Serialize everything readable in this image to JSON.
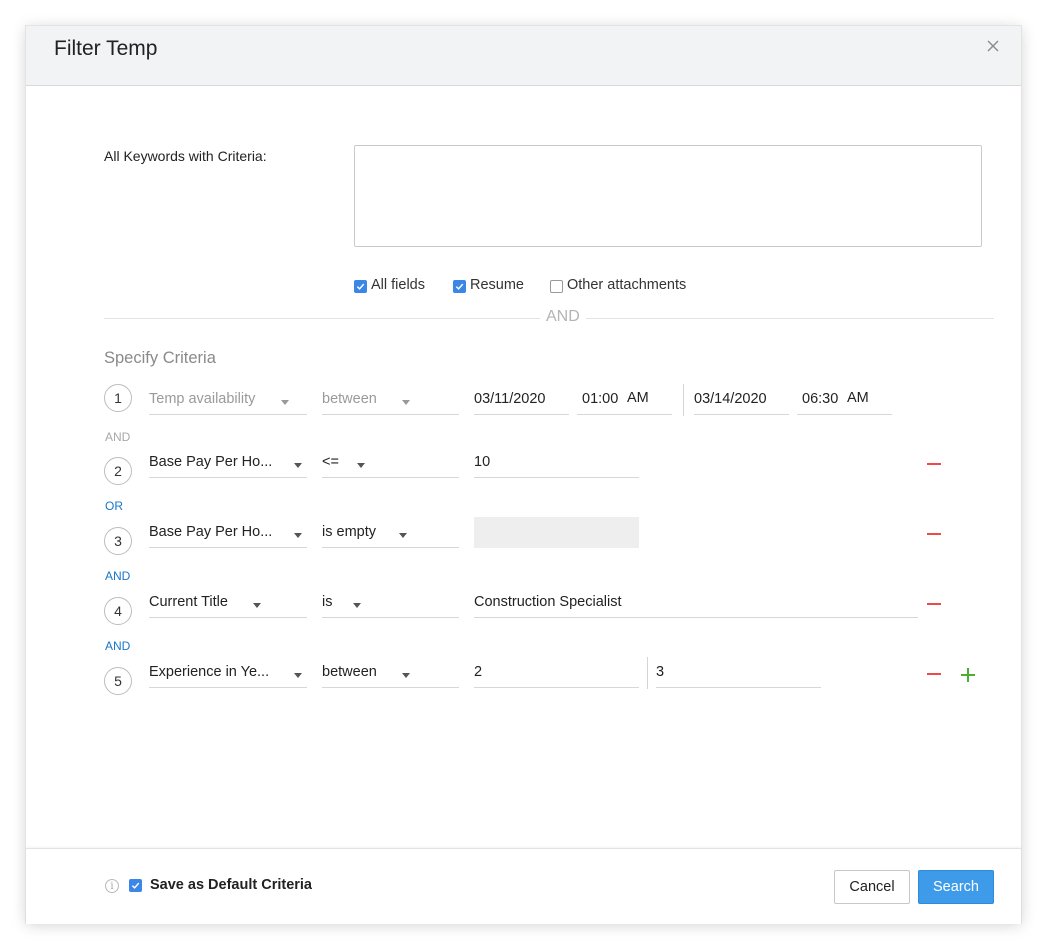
{
  "dialog": {
    "title": "Filter Temp",
    "close_icon": "close-icon"
  },
  "keywords": {
    "label": "All Keywords with Criteria:",
    "value": "",
    "options": [
      {
        "label": "All fields",
        "checked": true
      },
      {
        "label": "Resume",
        "checked": true
      },
      {
        "label": "Other attachments",
        "checked": false
      }
    ],
    "divider": "AND"
  },
  "criteria": {
    "title": "Specify Criteria",
    "rows": [
      {
        "number": "1",
        "field": "Temp availability",
        "operator": "between",
        "start_date": "03/11/2020",
        "start_time": "01:00",
        "start_ampm": "AM",
        "end_date": "03/14/2020",
        "end_time": "06:30",
        "end_ampm": "AM"
      },
      {
        "connector": "AND",
        "number": "2",
        "field": "Base Pay Per Ho...",
        "operator": "<=",
        "value": "10"
      },
      {
        "connector": "OR",
        "number": "3",
        "field": "Base Pay Per Ho...",
        "operator": "is empty",
        "value": ""
      },
      {
        "connector": "AND",
        "number": "4",
        "field": "Current Title",
        "operator": "is",
        "value": "Construction Specialist"
      },
      {
        "connector": "AND",
        "number": "5",
        "field": "Experience in Ye...",
        "operator": "between",
        "value": "2",
        "value2": "3"
      }
    ]
  },
  "footer": {
    "info_icon": "info-icon",
    "save_default_label": "Save as Default Criteria",
    "save_default_checked": true,
    "cancel_label": "Cancel",
    "search_label": "Search"
  },
  "colors": {
    "accent": "#3d9bea",
    "checkbox": "#3b86e6",
    "remove": "#ef4a4a",
    "add": "#4aae33",
    "connector_and_first": "#a8a8a8",
    "connector": "#1a76c9"
  }
}
